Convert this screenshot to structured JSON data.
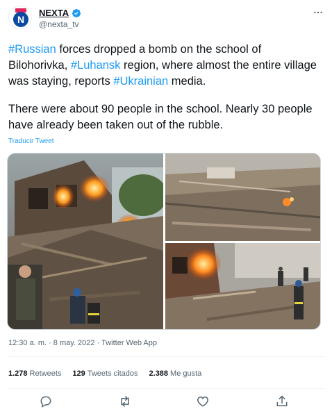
{
  "author": {
    "name": "NEXTA",
    "handle": "@nexta_tv",
    "avatar_letter": "N",
    "verified": true
  },
  "tweet": {
    "para1": [
      {
        "text": "#Russian",
        "hashtag": true
      },
      {
        "text": " forces dropped a bomb on the school of Bilohorivka, ",
        "hashtag": false
      },
      {
        "text": "#Luhansk",
        "hashtag": true
      },
      {
        "text": " region, where almost the entire village was staying, reports ",
        "hashtag": false
      },
      {
        "text": "#Ukrainian",
        "hashtag": true
      },
      {
        "text": " media.",
        "hashtag": false
      }
    ],
    "para2": "There were about 90 people in the school. Nearly 30 people have already been taken out of the rubble.",
    "translate_label": "Traducir Tweet"
  },
  "meta": {
    "timestamp": "12:30 a. m. · 8 may. 2022 · Twitter Web App"
  },
  "stats": {
    "retweets_count": "1.278",
    "retweets_label": "Retweets",
    "quotes_count": "129",
    "quotes_label": "Tweets citados",
    "likes_count": "2.388",
    "likes_label": "Me gusta"
  },
  "colors": {
    "link": "#1d9bf0",
    "text": "#0f1419",
    "secondary": "#536471",
    "divider": "#eff3f4"
  },
  "icons": {
    "more": "more-icon",
    "reply": "reply-icon",
    "retweet": "retweet-icon",
    "like": "heart-icon",
    "share": "share-icon",
    "verified": "verified-badge-icon"
  }
}
